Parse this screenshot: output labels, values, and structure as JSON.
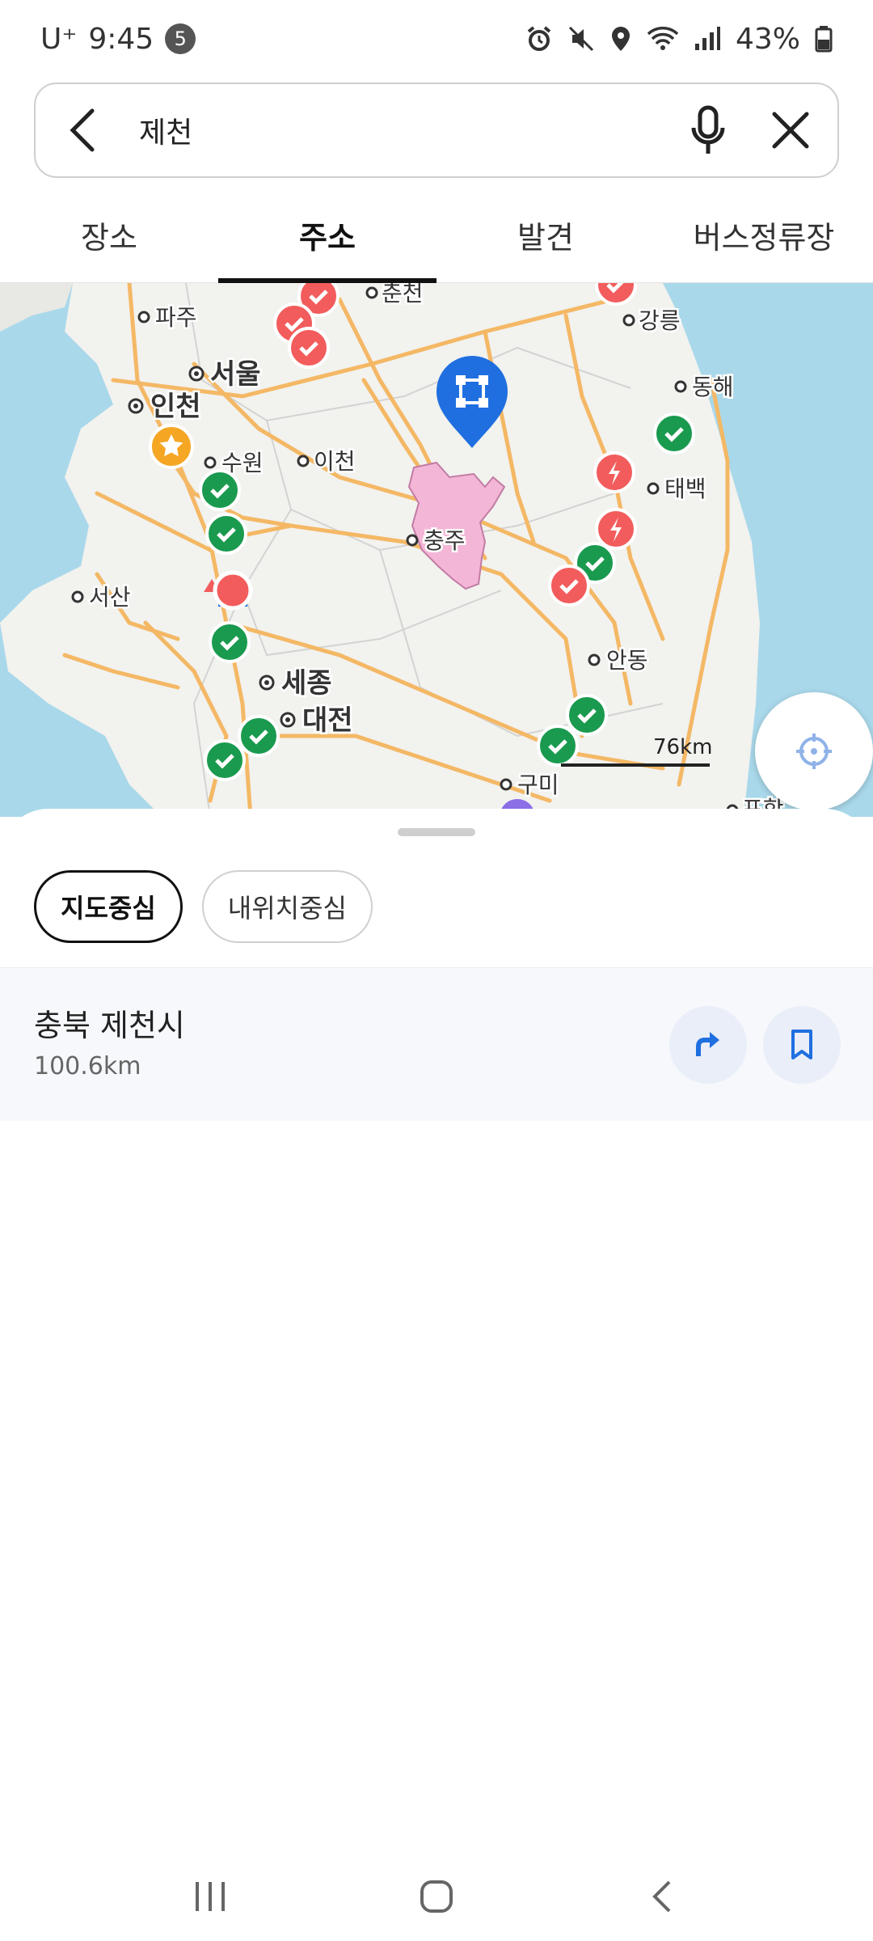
{
  "status": {
    "carrier": "U⁺",
    "time": "9:45",
    "notif_count": "5",
    "battery": "43%"
  },
  "search": {
    "query": "제천"
  },
  "tabs": [
    {
      "label": "장소"
    },
    {
      "label": "주소"
    },
    {
      "label": "발견"
    },
    {
      "label": "버스정류장"
    }
  ],
  "map": {
    "cities": {
      "paju": "파주",
      "chuncheon": "춘천",
      "gangneung": "강릉",
      "seoul": "서울",
      "donghae": "동해",
      "incheon": "인천",
      "suwon": "수원",
      "icheon": "이천",
      "taebaek": "태백",
      "chungju": "충주",
      "seosan": "서산",
      "andong": "안동",
      "sejong": "세종",
      "daejeon": "대전",
      "gumi": "구미",
      "pohang": "포항"
    },
    "scale": "76km"
  },
  "sheet": {
    "chips": [
      {
        "label": "지도중심"
      },
      {
        "label": "내위치중심"
      }
    ],
    "result": {
      "name": "충북 제천시",
      "distance": "100.6km"
    }
  },
  "colors": {
    "accent": "#1f6fe0",
    "water": "#a9d8ea",
    "land": "#f2f2ef",
    "road": "#f4b865",
    "marker_green": "#1a9a4f",
    "marker_red": "#f25c5c",
    "region_fill": "#f4b6d6"
  }
}
